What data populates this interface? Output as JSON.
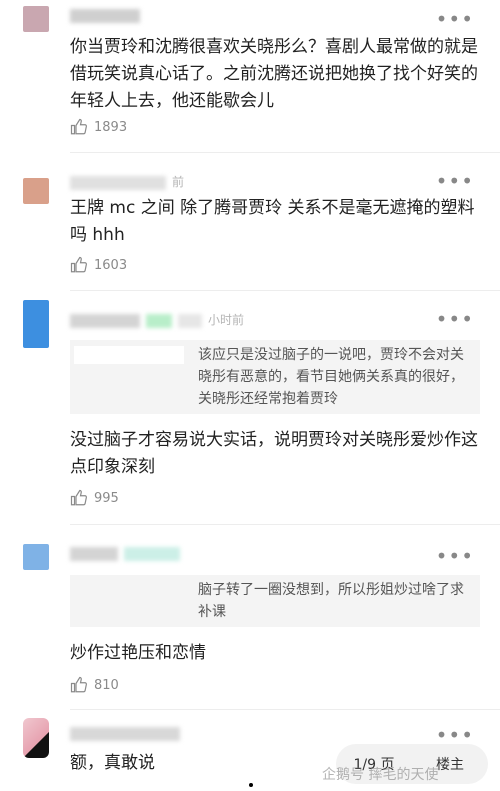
{
  "colors": {
    "text": "#222222",
    "meta": "#b5b5b5",
    "quote_bg": "#f4f4f4"
  },
  "comments": [
    {
      "avatar_color": "#c9a7b0",
      "meta": "",
      "text": "你当贾玲和沈腾很喜欢关晓彤么？喜剧人最常做的就是借玩笑说真心话了。之前沈腾还说把她换了找个好笑的年轻人上去，他还能歇会儿",
      "likes": "1893"
    },
    {
      "avatar_color": "#d9a08a",
      "meta": "前",
      "text": "王牌 mc 之间 除了腾哥贾玲 关系不是毫无遮掩的塑料吗 hhh",
      "likes": "1603"
    },
    {
      "avatar_color": "#3d8fe0",
      "meta": "小时前",
      "quote": "该应只是没过脑子的一说吧，贾玲不会对关晓彤有恶意的，看节目她俩关系真的很好，关晓彤还经常抱着贾玲",
      "text": "没过脑子才容易说大实话，说明贾玲对关晓彤爱炒作这点印象深刻",
      "likes": "995"
    },
    {
      "avatar_color": "#7fb2e6",
      "meta": "",
      "quote": "脑子转了一圈没想到，所以彤姐炒过啥了求补课",
      "text": "炒作过艳压和恋情",
      "likes": "810"
    },
    {
      "avatar_color": "#e7a2b0",
      "meta": "",
      "text": "额，真敢说",
      "likes": ""
    }
  ],
  "more_icon": "more-dots-icon",
  "like_icon": "thumb-up-icon",
  "pager": {
    "page": "1/9 页",
    "owner": "楼主"
  },
  "watermark": "企鹅号 摔毛的天使"
}
